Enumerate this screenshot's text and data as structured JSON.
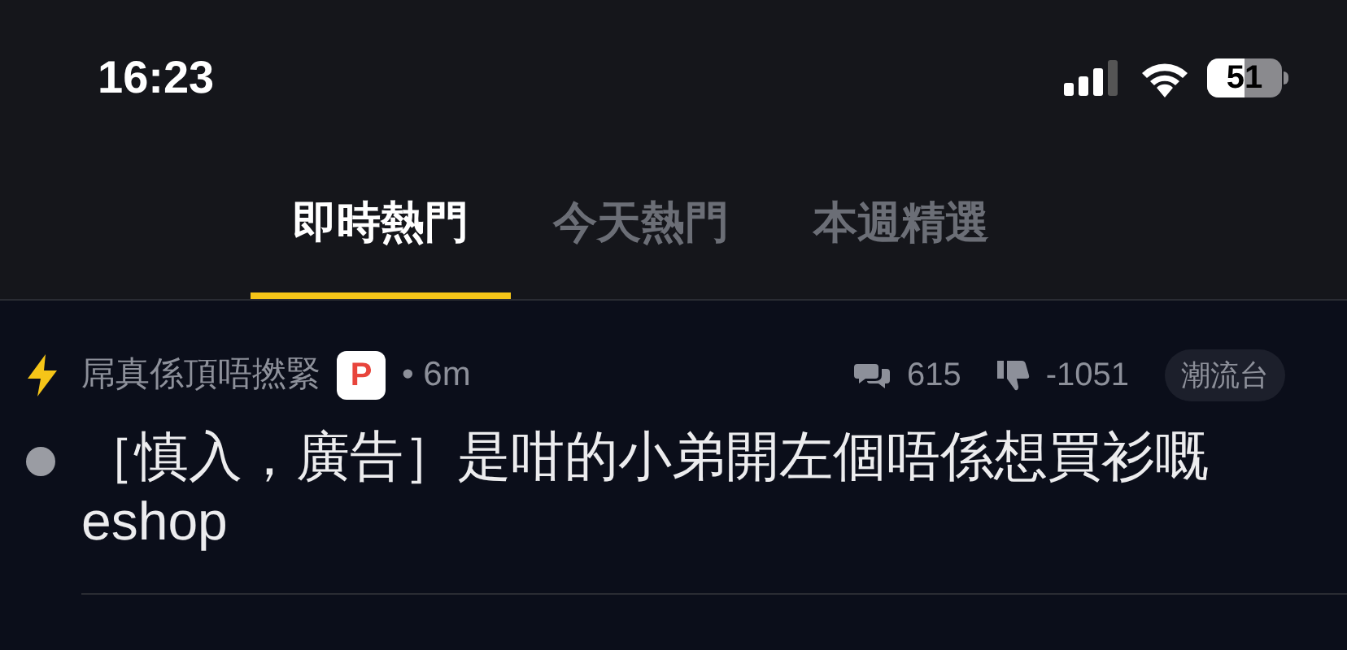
{
  "status_bar": {
    "time": "16:23",
    "battery": "51"
  },
  "tabs": [
    {
      "label": "即時熱門",
      "selected": true
    },
    {
      "label": "今天熱門",
      "selected": false
    },
    {
      "label": "本週精選",
      "selected": false
    }
  ],
  "threads": [
    {
      "hot": true,
      "author": "屌真係頂唔撚緊",
      "badge": "P",
      "age": "• 6m",
      "replies": "615",
      "votes": "-1051",
      "category": "潮流台",
      "unread": true,
      "title": "［慎入，廣告］是咁的小弟開左個唔係想買衫嘅 eshop"
    }
  ]
}
